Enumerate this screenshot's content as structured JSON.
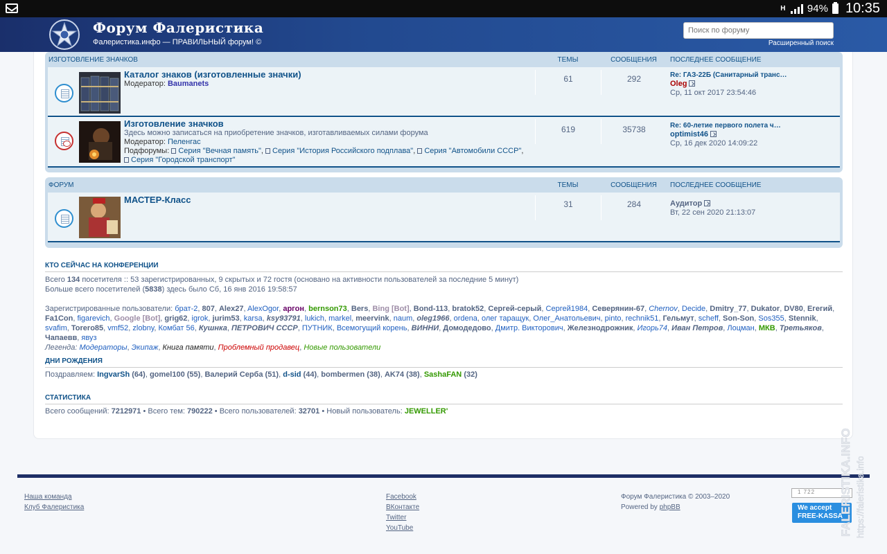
{
  "status_bar": {
    "network": "H",
    "battery": "94%",
    "time": "10:35"
  },
  "header": {
    "title": "Форум Фалеристика",
    "description": "Фалеристика.инфо — ПРАВИЛЬНЫЙ форум! ©",
    "search_placeholder": "Поиск по форуму",
    "advanced_search": "Расширенный поиск"
  },
  "section1": {
    "title": "ИЗГОТОВЛЕНИЕ ЗНАЧКОВ",
    "col_topics": "ТЕМЫ",
    "col_posts": "СООБЩЕНИЯ",
    "col_last": "ПОСЛЕДНЕЕ СООБЩЕНИЕ",
    "forums": [
      {
        "title": "Каталог знаков (изготовленные значки)",
        "moderator_label": "Модератор:",
        "moderator": "Baumanets",
        "topics": "61",
        "posts": "292",
        "last_title": "Re: ГАЗ-22Б (Санитарный транс…",
        "last_user": "Oleg",
        "last_date": "Ср, 11 окт 2017 23:54:46"
      },
      {
        "title": "Изготовление значков",
        "description": "Здесь можно записаться на приобретение значков, изготавливаемых силами форума",
        "moderator_label": "Модератор:",
        "moderator": "Пеленгас",
        "subforums_label": "Подфорумы:",
        "subforums": [
          "Серия \"Вечная память\"",
          "Серия \"История Российского подплава\"",
          "Серия \"Автомобили СССР\"",
          "Серия \"Городской транспорт\""
        ],
        "topics": "619",
        "posts": "35738",
        "last_title": "Re: 60-летие первого полета ч…",
        "last_user": "optimist46",
        "last_date": "Ср, 16 дек 2020 14:09:22"
      }
    ]
  },
  "section2": {
    "title": "ФОРУМ",
    "col_topics": "ТЕМЫ",
    "col_posts": "СООБЩЕНИЯ",
    "col_last": "ПОСЛЕДНЕЕ СООБЩЕНИЕ",
    "forums": [
      {
        "title": "МАСТЕР-Класс",
        "topics": "31",
        "posts": "284",
        "last_user": "Аудитор",
        "last_date": "Вт, 22 сен 2020 21:13:07"
      }
    ]
  },
  "online": {
    "title": "КТО СЕЙЧАС НА КОНФЕРЕНЦИИ",
    "total_prefix": "Всего",
    "total": "134",
    "total_suffix": "посетителя :: 53 зарегистрированных, 9 скрытых и 72 гостя (основано на активности пользователей за последние 5 минут)",
    "record_prefix": "Больше всего посетителей (",
    "record": "5838",
    "record_suffix": ") здесь было Сб, 16 янв 2016 19:58:57",
    "registered_label": "Зарегистрированные пользователи:",
    "users": [
      {
        "n": "брат-2",
        "c": "lblue"
      },
      {
        "n": "807",
        "c": "bold"
      },
      {
        "n": "Alex27",
        "c": "bold"
      },
      {
        "n": "AlexOgor",
        "c": "lblue"
      },
      {
        "n": "аргон",
        "c": "purple"
      },
      {
        "n": "bernson73",
        "c": "green"
      },
      {
        "n": "Bers",
        "c": "bold"
      },
      {
        "n": "Bing [Bot]",
        "c": "gray"
      },
      {
        "n": "Bond-113",
        "c": "bold"
      },
      {
        "n": "bratok52",
        "c": "bold"
      },
      {
        "n": "Сергей-серый",
        "c": "bold"
      },
      {
        "n": "Сергей1984",
        "c": "lblue"
      },
      {
        "n": "Северянин-67",
        "c": "bold"
      },
      {
        "n": "Chernov",
        "c": "lblue-i"
      },
      {
        "n": "Decide",
        "c": "lblue"
      },
      {
        "n": "Dmitry_77",
        "c": "bold"
      },
      {
        "n": "Dukator",
        "c": "bold"
      },
      {
        "n": "DV80",
        "c": "bold"
      },
      {
        "n": "Егегий",
        "c": "bold"
      },
      {
        "n": "Fa1Con",
        "c": "bold"
      },
      {
        "n": "figarevich",
        "c": "lblue"
      },
      {
        "n": "Google [Bot]",
        "c": "gray"
      },
      {
        "n": "grig62",
        "c": "bold"
      },
      {
        "n": "igrok",
        "c": "lblue"
      },
      {
        "n": "jurim53",
        "c": "bold"
      },
      {
        "n": "karsa",
        "c": "lblue"
      },
      {
        "n": "ksy93791",
        "c": "bold-i"
      },
      {
        "n": "lukich",
        "c": "lblue"
      },
      {
        "n": "markel",
        "c": "lblue"
      },
      {
        "n": "meervink",
        "c": "bold"
      },
      {
        "n": "naum",
        "c": "lblue"
      },
      {
        "n": "oleg1966",
        "c": "bold-i"
      },
      {
        "n": "ordena",
        "c": "lblue"
      },
      {
        "n": "олег таращук",
        "c": "lblue"
      },
      {
        "n": "Олег_Анатольевич",
        "c": "lblue"
      },
      {
        "n": "pinto",
        "c": "lblue"
      },
      {
        "n": "rechnik51",
        "c": "lblue"
      },
      {
        "n": "Гельмут",
        "c": "bold"
      },
      {
        "n": "scheff",
        "c": "lblue"
      },
      {
        "n": "Son-Son",
        "c": "bold"
      },
      {
        "n": "Sos355",
        "c": "lblue"
      },
      {
        "n": "Stennik",
        "c": "bold"
      },
      {
        "n": "svafim",
        "c": "lblue"
      },
      {
        "n": "Torero85",
        "c": "bold"
      },
      {
        "n": "vmf52",
        "c": "lblue"
      },
      {
        "n": "zlobny",
        "c": "lblue"
      },
      {
        "n": "Комбат 56",
        "c": "lblue"
      },
      {
        "n": "Кушнка",
        "c": "bold-i"
      },
      {
        "n": "ПЕТРОВИЧ СССР",
        "c": "bold-i"
      },
      {
        "n": "ПУТНИК",
        "c": "lblue"
      },
      {
        "n": "Всемогущий корень",
        "c": "lblue"
      },
      {
        "n": "ВИННИ",
        "c": "bold-i"
      },
      {
        "n": "Домодедово",
        "c": "bold"
      },
      {
        "n": "Дмитр. Викторович",
        "c": "lblue"
      },
      {
        "n": "Железнодрожник",
        "c": "bold"
      },
      {
        "n": "Игорь74",
        "c": "lblue-i"
      },
      {
        "n": "Иван Петров",
        "c": "bold-i"
      },
      {
        "n": "Лоцман",
        "c": "lblue"
      },
      {
        "n": "МКВ",
        "c": "green"
      },
      {
        "n": "Третьяков",
        "c": "bold-i"
      },
      {
        "n": "Чапаевв",
        "c": "bold"
      },
      {
        "n": "явуз",
        "c": "lblue"
      }
    ],
    "legend_label": "Легенда:",
    "legend": [
      {
        "n": "Модераторы",
        "c": "lblue-i"
      },
      {
        "n": "Экипаж",
        "c": "lblue-i"
      },
      {
        "n": "Книга памяти",
        "c": "black-i"
      },
      {
        "n": "Проблемный продавец",
        "c": "red-i"
      },
      {
        "n": "Новые пользователи",
        "c": "green-i"
      }
    ]
  },
  "birthdays": {
    "title": "ДНИ РОЖДЕНИЯ",
    "label": "Поздравляем:",
    "people": [
      {
        "n": "IngvarSh",
        "age": "64",
        "c": "blue"
      },
      {
        "n": "gomel100",
        "age": "55",
        "c": "bold"
      },
      {
        "n": "Валерий Серба",
        "age": "51",
        "c": "bold"
      },
      {
        "n": "d-sid",
        "age": "44",
        "c": "blue"
      },
      {
        "n": "bombermen",
        "age": "38",
        "c": "bold"
      },
      {
        "n": "AK74",
        "age": "38",
        "c": "bold"
      },
      {
        "n": "SashaFAN",
        "age": "32",
        "c": "green"
      }
    ]
  },
  "statistics": {
    "title": "СТАТИСТИКА",
    "posts_label": "Всего сообщений:",
    "posts": "7212971",
    "topics_label": "Всего тем:",
    "topics": "790222",
    "users_label": "Всего пользователей:",
    "users": "32701",
    "newest_label": "Новый пользователь:",
    "newest": "JEWELLER'"
  },
  "footer": {
    "links_left": [
      "Наша команда",
      "Клуб Фалеристика"
    ],
    "links_social": [
      "Facebook",
      "ВКонтакте",
      "Twitter",
      "YouTube"
    ],
    "copyright": "Форум Фалеристика © 2003–2020",
    "powered_label": "Powered by",
    "powered_link": "phpBB",
    "counter": "1 722",
    "payment_line1": "We accept",
    "payment_line2": "FREE-KASSA",
    "watermark": "FALERISTIKA.INFO https://faleristika.info"
  },
  "colors": {
    "header": "#22498f",
    "link": "#105289",
    "row_bg": "#ecf3f7",
    "block_bg": "#cadceb"
  }
}
